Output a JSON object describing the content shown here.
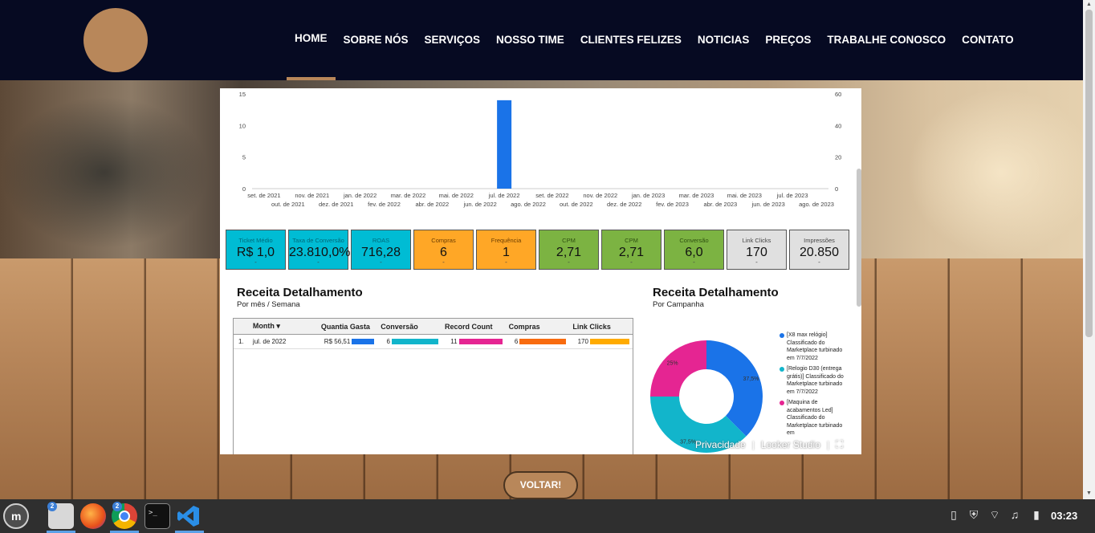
{
  "nav": {
    "items": [
      "HOME",
      "SOBRE NÓS",
      "SERVIÇOS",
      "NOSSO TIME",
      "CLIENTES FELIZES",
      "NOTICIAS",
      "PREÇOS",
      "TRABALHE CONOSCO",
      "CONTATO"
    ],
    "active_index": 0
  },
  "chart_data": {
    "type": "bar",
    "title": "",
    "xlabel": "",
    "ylabel": "",
    "left_ticks": [
      "15",
      "10",
      "5",
      "0"
    ],
    "right_ticks": [
      "60",
      "40",
      "20",
      "0"
    ],
    "ylim": [
      0,
      15
    ],
    "categories": [
      "set. de 2021",
      "out. de 2021",
      "nov. de 2021",
      "dez. de 2021",
      "jan. de 2022",
      "fev. de 2022",
      "mar. de 2022",
      "abr. de 2022",
      "mai. de 2022",
      "jun. de 2022",
      "jul. de 2022",
      "ago. de 2022",
      "set. de 2022",
      "out. de 2022",
      "nov. de 2022",
      "dez. de 2022",
      "jan. de 2023",
      "fev. de 2023",
      "mar. de 2023",
      "abr. de 2023",
      "mai. de 2023",
      "jun. de 2023",
      "jul. de 2023",
      "ago. de 2023"
    ],
    "values": [
      0,
      0,
      0,
      0,
      0,
      0,
      0,
      0,
      0,
      0,
      14,
      0,
      0,
      0,
      0,
      0,
      0,
      0,
      0,
      0,
      0,
      0,
      0,
      0
    ],
    "bar_color": "#1a73e8"
  },
  "scorecards": [
    {
      "label": "Ticket Médio",
      "value": "R$ 1,0",
      "color": "cyan"
    },
    {
      "label": "Taxa de Conversão",
      "value": "23.810,0%",
      "color": "cyan"
    },
    {
      "label": "ROAS",
      "value": "716,28",
      "color": "cyan"
    },
    {
      "label": "Compras",
      "value": "6",
      "color": "orange"
    },
    {
      "label": "Frequência",
      "value": "1",
      "color": "orange"
    },
    {
      "label": "CPM",
      "value": "2,71",
      "color": "green"
    },
    {
      "label": "CPM",
      "value": "2,71",
      "color": "green"
    },
    {
      "label": "Conversão",
      "value": "6,0",
      "color": "green"
    },
    {
      "label": "Link Clicks",
      "value": "170",
      "color": "grey"
    },
    {
      "label": "Impressões",
      "value": "20.850",
      "color": "grey"
    }
  ],
  "table_section": {
    "title": "Receita Detalhamento",
    "subtitle": "Por mês / Semana"
  },
  "donut_section": {
    "title": "Receita Detalhamento",
    "subtitle": "Por Campanha"
  },
  "table": {
    "headers": [
      "Month ▾",
      "Quantia Gasta",
      "Conversão",
      "Record Count",
      "Compras",
      "Link Clicks"
    ],
    "rows": [
      {
        "index": "1.",
        "month": "jul. de 2022",
        "gasta": "R$ 56,51",
        "conversao": "6",
        "record": "11",
        "compras": "6",
        "clicks": "170"
      }
    ],
    "bar_colors": [
      "#1a73e8",
      "#12b5cb",
      "#e52592",
      "#f86b0f",
      "#ffab00"
    ]
  },
  "donut": {
    "slices": [
      {
        "label": "[X8 max relógio] Classificado do Marketplace turbinado em 7/7/2022",
        "value": 37.5,
        "pct": "37,5%",
        "color": "#1a73e8"
      },
      {
        "label": "[Relogio D30 (entrega grátis)] Classificado do Marketplace turbinado em 7/7/2022",
        "value": 37.5,
        "pct": "37,5%",
        "color": "#12b5cb"
      },
      {
        "label": "[Maquina de acabamentos Led] Classificado do Marketplace turbinado em",
        "value": 25,
        "pct": "25%",
        "color": "#e52592"
      }
    ]
  },
  "embed_footer": {
    "privacy": "Privacidade",
    "brand": "Looker Studio"
  },
  "voltar_label": "VOLTAR!",
  "taskbar": {
    "clock": "03:23",
    "files_badge": "2",
    "chrome_badge": "2"
  }
}
